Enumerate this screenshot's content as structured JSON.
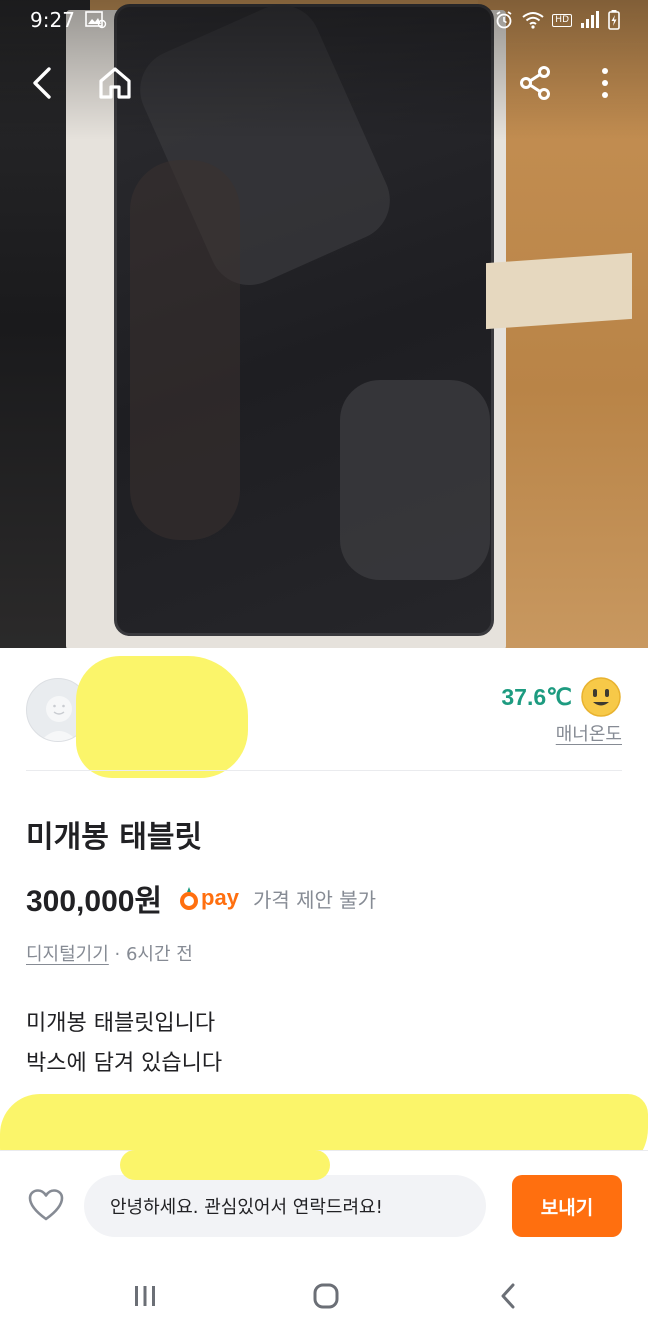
{
  "status_bar": {
    "time": "9:27",
    "hd_label": "HD"
  },
  "seller": {
    "manner_temp": "37.6℃",
    "manner_label": "매너온도"
  },
  "product": {
    "title": "미개봉 태블릿",
    "price": "300,000원",
    "pay_label": "pay",
    "price_offer": "가격 제안 불가",
    "category": "디지털기기",
    "time_ago": "6시간 전",
    "description": [
      "미개봉 태블릿입니다",
      "박스에 담겨 있습니다"
    ]
  },
  "bottom_bar": {
    "chat_message": "안녕하세요. 관심있어서 연락드려요!",
    "send_label": "보내기"
  },
  "colors": {
    "accent": "#ff6f0f",
    "temperature": "#1d9b80",
    "redaction": "#fbf56a"
  },
  "icons": [
    "back-icon",
    "home-icon",
    "share-icon",
    "more-icon",
    "heart-icon",
    "smile-face-icon",
    "recent-apps-icon",
    "home-circle-icon",
    "back-chevron-icon"
  ]
}
